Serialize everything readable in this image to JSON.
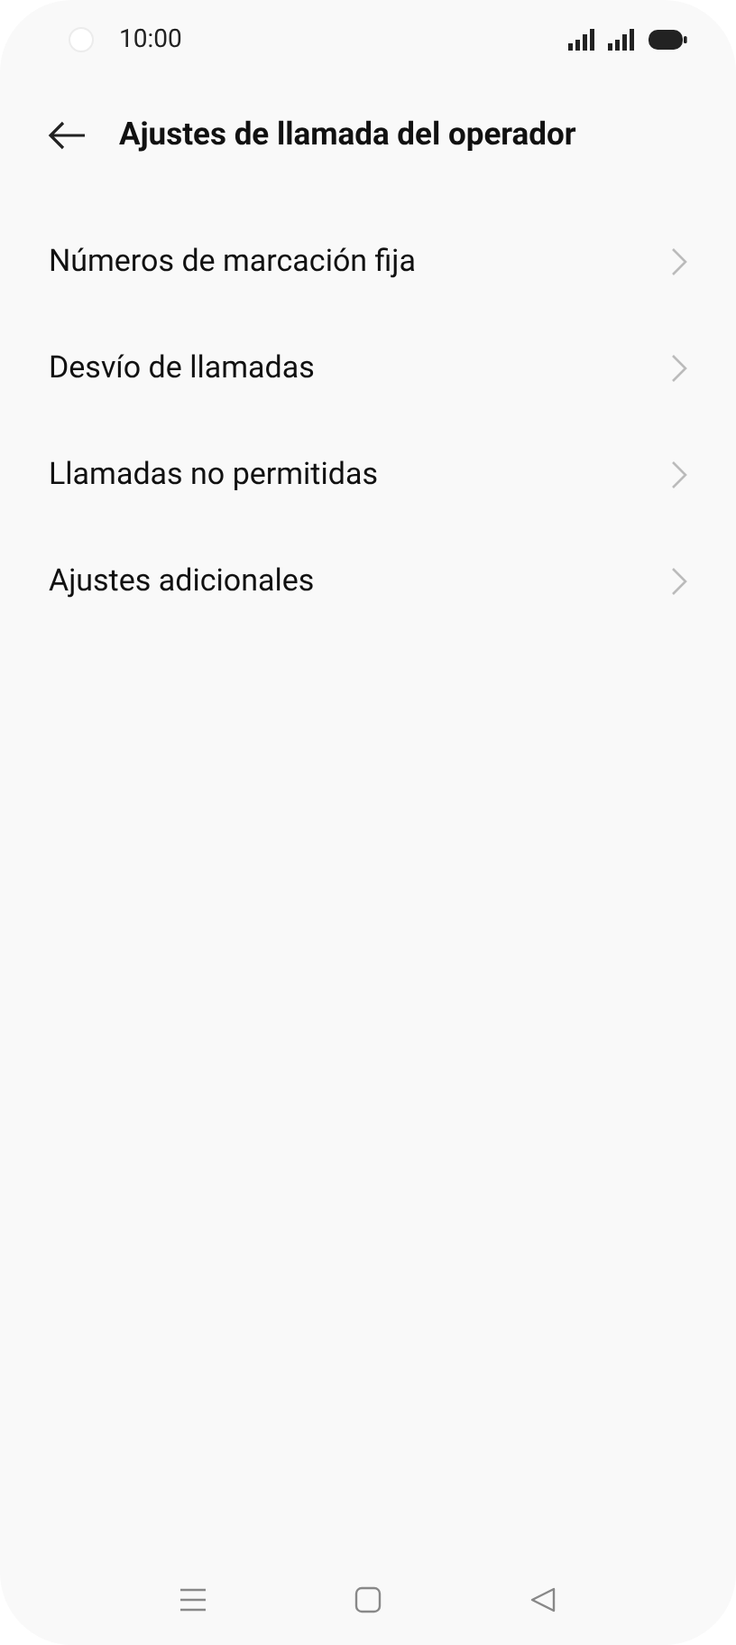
{
  "status_bar": {
    "time": "10:00"
  },
  "header": {
    "title": "Ajustes de llamada del operador"
  },
  "items": [
    {
      "label": "Números de marcación fija"
    },
    {
      "label": "Desvío de llamadas"
    },
    {
      "label": "Llamadas no permitidas"
    },
    {
      "label": "Ajustes adicionales"
    }
  ]
}
